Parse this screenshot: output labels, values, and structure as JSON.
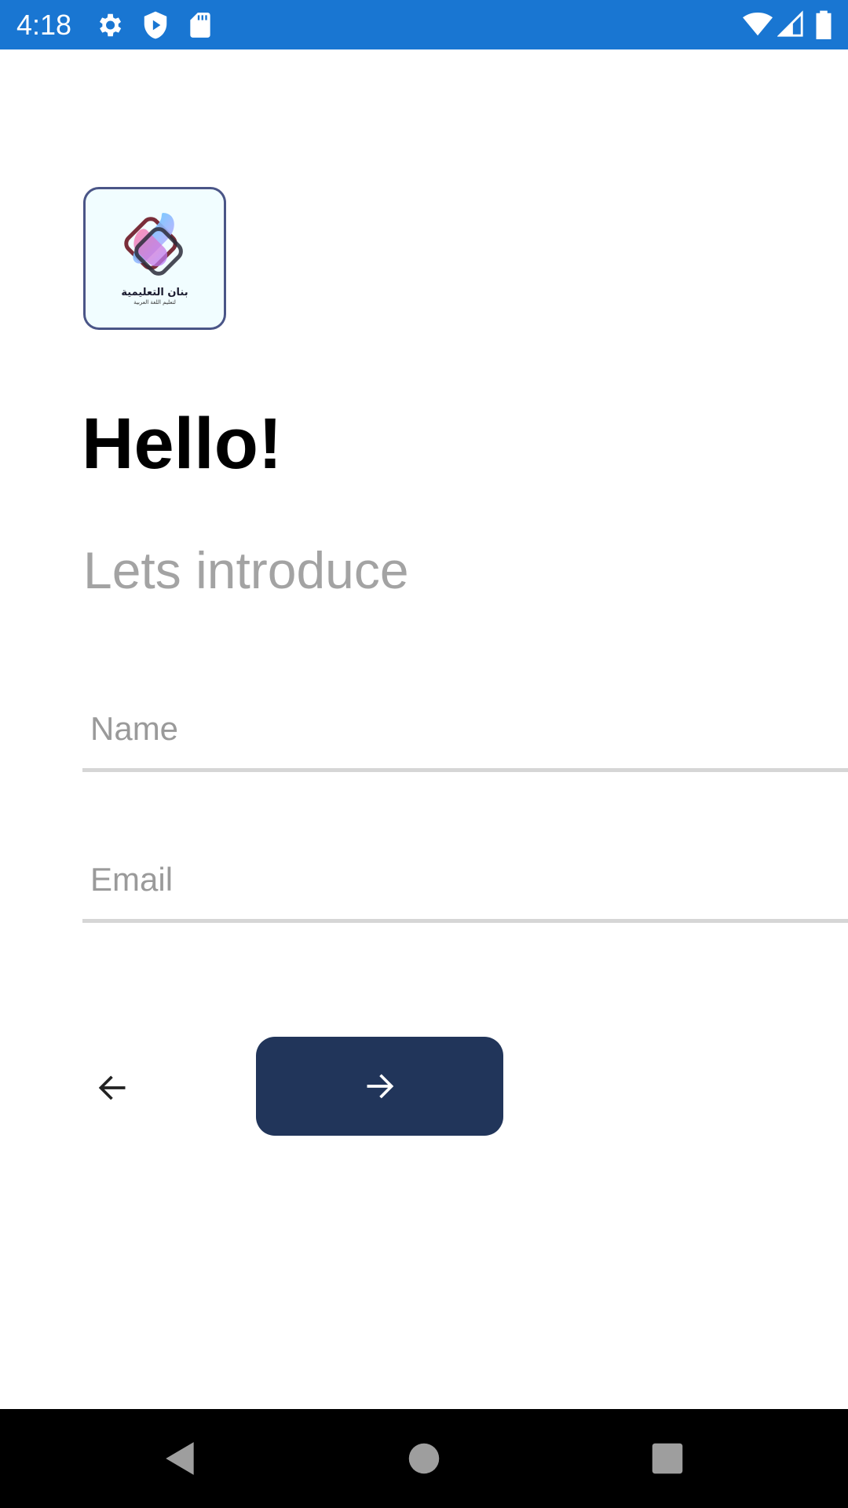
{
  "status_bar": {
    "time": "4:18",
    "left_icons": [
      "gear-icon",
      "play-shield-icon",
      "sd-card-icon"
    ],
    "right_icons": [
      "wifi-icon",
      "signal-icon",
      "battery-icon"
    ],
    "background": "#1976D2"
  },
  "logo": {
    "text": "بنان التعليمية",
    "subtext": "لتعليم اللغة العربية"
  },
  "header": {
    "title": "Hello!",
    "subtitle": "Lets introduce"
  },
  "form": {
    "name_placeholder": "Name",
    "email_placeholder": "Email"
  },
  "actions": {
    "back_icon": "arrow-left-icon",
    "next_icon": "arrow-right-icon",
    "next_background": "#21355a"
  },
  "nav_bar": {
    "icons": [
      "nav-back-icon",
      "nav-home-icon",
      "nav-recents-icon"
    ]
  }
}
